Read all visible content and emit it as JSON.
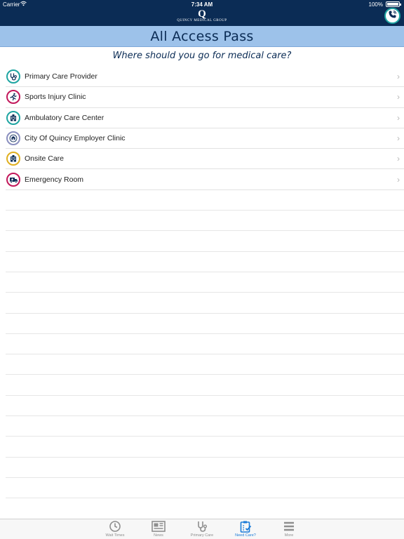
{
  "status_bar": {
    "carrier": "Carrier",
    "time": "7:34 AM",
    "battery": "100%"
  },
  "header": {
    "logo_letter": "Q",
    "logo_name": "QUINCY MEDICAL GROUP"
  },
  "title": "All Access Pass",
  "subtitle": "Where should you go for medical care?",
  "list": [
    {
      "label": "Primary Care Provider",
      "icon": "stethoscope-icon",
      "ring": "#1fa5a2"
    },
    {
      "label": "Sports Injury Clinic",
      "icon": "running-person-icon",
      "ring": "#c2185b"
    },
    {
      "label": "Ambulatory Care Center",
      "icon": "building-icon",
      "ring": "#1fa5a2"
    },
    {
      "label": "City Of Quincy Employer Clinic",
      "icon": "city-seal-icon",
      "ring": "#8a8fbf"
    },
    {
      "label": "Onsite Care",
      "icon": "building-icon",
      "ring": "#e0b020"
    },
    {
      "label": "Emergency Room",
      "icon": "ambulance-icon",
      "ring": "#c2185b"
    }
  ],
  "tabs": [
    {
      "label": "Wait Times",
      "icon": "clock-icon",
      "active": false
    },
    {
      "label": "News",
      "icon": "newspaper-icon",
      "active": false
    },
    {
      "label": "Primary Care",
      "icon": "stethoscope-icon",
      "active": false
    },
    {
      "label": "Need Care?",
      "icon": "clipboard-check-icon",
      "active": true
    },
    {
      "label": "More",
      "icon": "menu-icon",
      "active": false
    }
  ],
  "colors": {
    "navy": "#0b2c55",
    "title_band": "#9dc2ea",
    "active_tab": "#1a7bd8"
  }
}
